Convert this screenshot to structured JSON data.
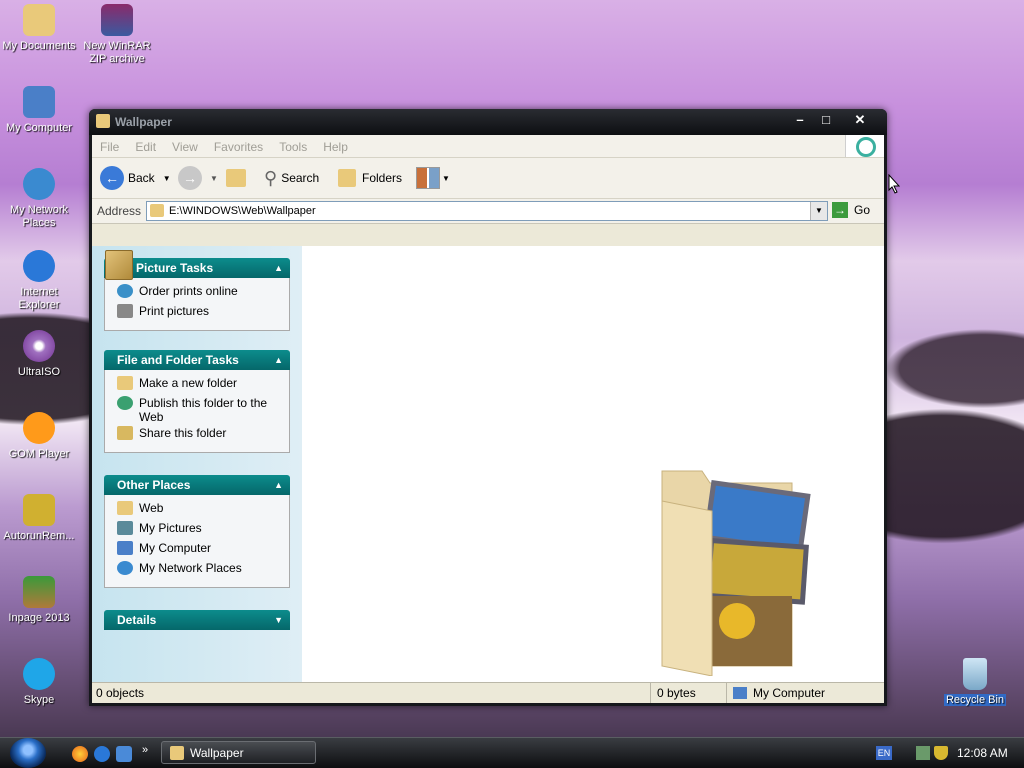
{
  "desktop": {
    "icons": [
      {
        "label": "My Documents"
      },
      {
        "label": "New WinRAR ZIP archive"
      },
      {
        "label": "My Computer"
      },
      {
        "label": "My Network Places"
      },
      {
        "label": "Internet Explorer"
      },
      {
        "label": "UltraISO"
      },
      {
        "label": "GOM Player"
      },
      {
        "label": "AutorunRem..."
      },
      {
        "label": "Inpage 2013"
      },
      {
        "label": "Skype"
      },
      {
        "label": "Recycle Bin"
      }
    ]
  },
  "window": {
    "title": "Wallpaper",
    "menu": [
      "File",
      "Edit",
      "View",
      "Favorites",
      "Tools",
      "Help"
    ],
    "toolbar": {
      "back": "Back",
      "search": "Search",
      "folders": "Folders"
    },
    "address": {
      "label": "Address",
      "value": "E:\\WINDOWS\\Web\\Wallpaper",
      "go": "Go"
    },
    "tasks": {
      "picture_tasks": {
        "title": "Picture Tasks",
        "items": [
          "Order prints online",
          "Print pictures"
        ]
      },
      "file_folder_tasks": {
        "title": "File and Folder Tasks",
        "items": [
          "Make a new folder",
          "Publish this folder to the Web",
          "Share this folder"
        ]
      },
      "other_places": {
        "title": "Other Places",
        "items": [
          "Web",
          "My Pictures",
          "My Computer",
          "My Network Places"
        ]
      },
      "details": {
        "title": "Details"
      }
    },
    "status": {
      "objects": "0 objects",
      "size": "0 bytes",
      "location": "My Computer"
    }
  },
  "taskbar": {
    "active_task": "Wallpaper",
    "language": "EN",
    "clock": "12:08 AM"
  }
}
